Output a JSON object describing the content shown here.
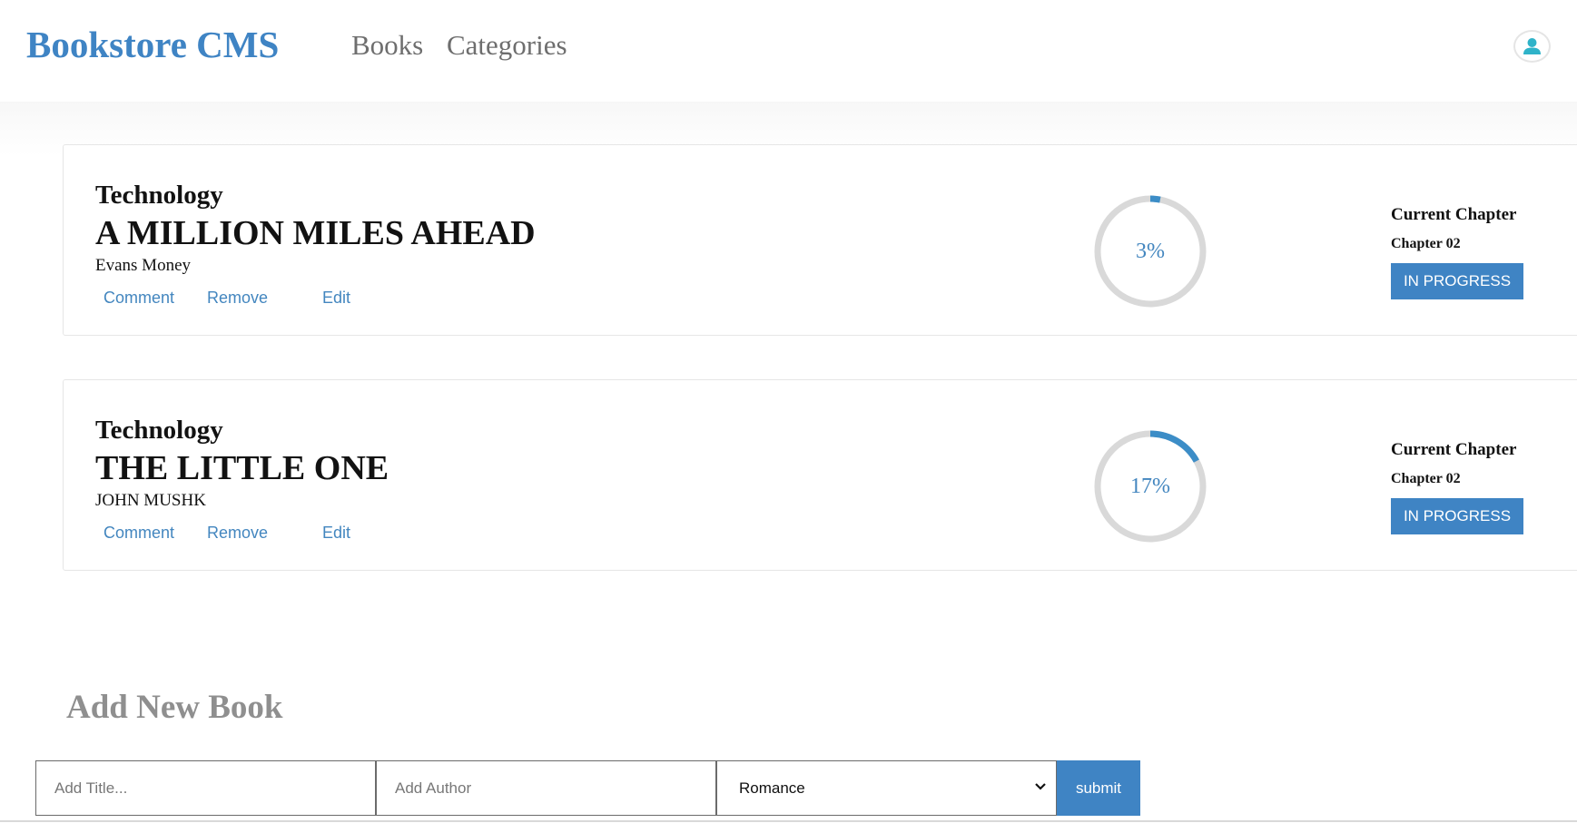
{
  "header": {
    "brand": "Bookstore CMS",
    "nav": [
      {
        "label": "Books"
      },
      {
        "label": "Categories"
      }
    ],
    "user_icon": "user-icon"
  },
  "books": [
    {
      "category": "Technology",
      "title": "A MILLION MILES AHEAD",
      "author": "Evans Money",
      "actions": {
        "comment": "Comment",
        "remove": "Remove",
        "edit": "Edit"
      },
      "progress": 3,
      "progress_text": "3%",
      "chapter_label": "Current Chapter",
      "chapter": "Chapter 02",
      "status_button": "IN PROGRESS"
    },
    {
      "category": "Technology",
      "title": "THE LITTLE ONE",
      "author": "JOHN MUSHK",
      "actions": {
        "comment": "Comment",
        "remove": "Remove",
        "edit": "Edit"
      },
      "progress": 17,
      "progress_text": "17%",
      "chapter_label": "Current Chapter",
      "chapter": "Chapter 02",
      "status_button": "IN PROGRESS"
    }
  ],
  "add_book": {
    "heading": "Add New Book",
    "title_placeholder": "Add Title...",
    "title_value": "",
    "author_placeholder": "Add Author",
    "author_value": "",
    "category_selected": "Romance",
    "submit_label": "submit"
  },
  "colors": {
    "accent": "#3f84c4",
    "progress_arc": "#3c8dc7",
    "progress_track": "#d9d9d9",
    "muted_text": "#8f8f8f"
  }
}
